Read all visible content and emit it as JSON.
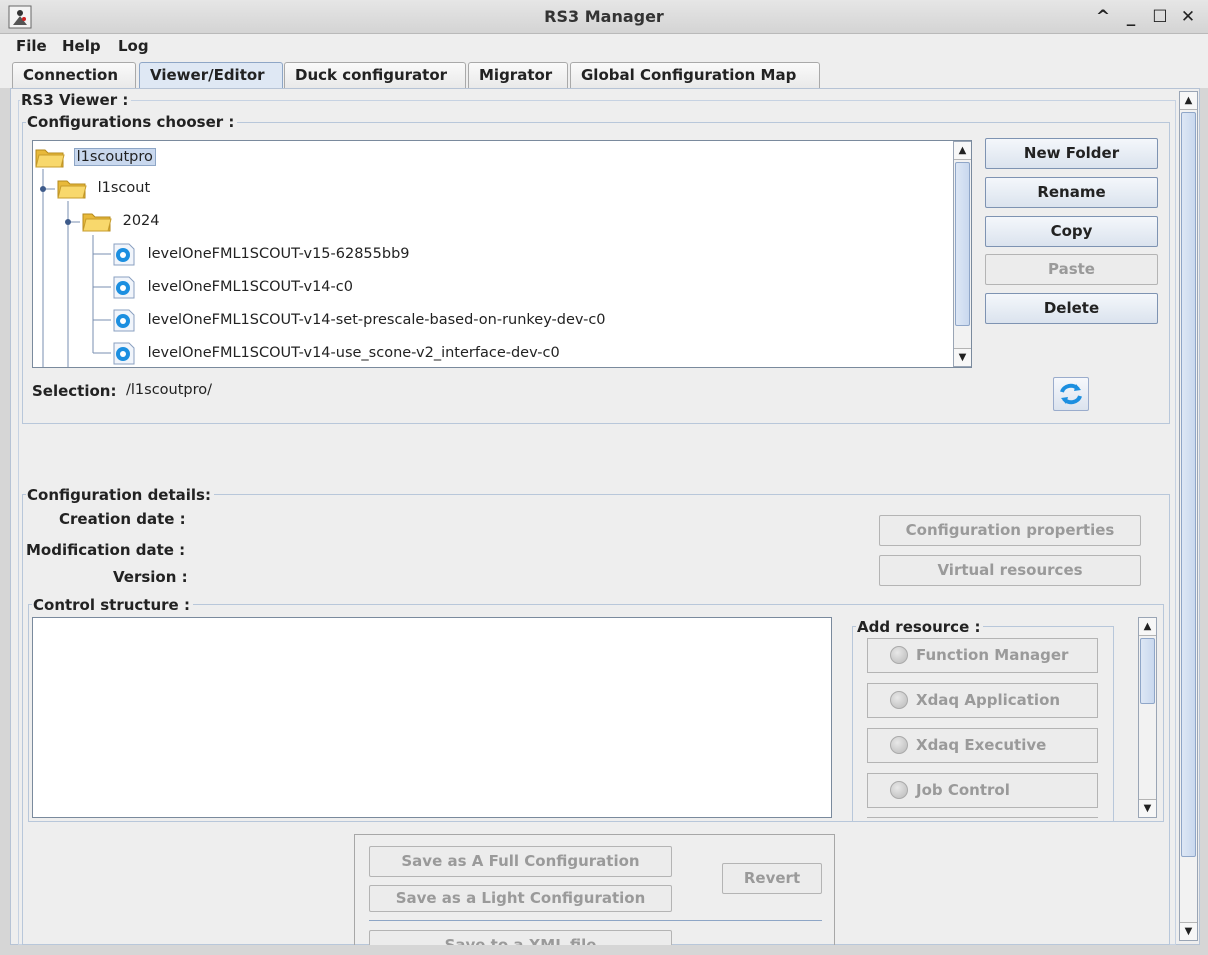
{
  "window": {
    "title": "RS3 Manager",
    "controls": {
      "collapse": "^",
      "minimize": "_",
      "maximize": "☐",
      "close": "✕"
    }
  },
  "menu": [
    "File",
    "Help",
    "Log"
  ],
  "tabs": [
    {
      "label": "Connection",
      "active": false
    },
    {
      "label": "Viewer/Editor",
      "active": true
    },
    {
      "label": "Duck configurator",
      "active": false
    },
    {
      "label": "Migrator",
      "active": false
    },
    {
      "label": "Global Configuration Map",
      "active": false
    }
  ],
  "viewer": {
    "legend": "RS3 Viewer :",
    "chooser_legend": "Configurations chooser :",
    "tree": [
      {
        "label": "l1scoutpro",
        "type": "folder",
        "level": 0,
        "selected": true
      },
      {
        "label": "l1scout",
        "type": "folder",
        "level": 1,
        "selected": false
      },
      {
        "label": "2024",
        "type": "folder",
        "level": 2,
        "selected": false
      },
      {
        "label": "levelOneFML1SCOUT-v15-62855bb9",
        "type": "config",
        "level": 3,
        "selected": false
      },
      {
        "label": "levelOneFML1SCOUT-v14-c0",
        "type": "config",
        "level": 3,
        "selected": false
      },
      {
        "label": "levelOneFML1SCOUT-v14-set-prescale-based-on-runkey-dev-c0",
        "type": "config",
        "level": 3,
        "selected": false
      },
      {
        "label": "levelOneFML1SCOUT-v14-use_scone-v2_interface-dev-c0",
        "type": "config",
        "level": 3,
        "selected": false
      }
    ],
    "buttons": {
      "new_folder": "New Folder",
      "rename": "Rename",
      "copy": "Copy",
      "paste": "Paste",
      "delete": "Delete"
    },
    "selection_label": "Selection:",
    "selection_value": "/l1scoutpro/"
  },
  "details": {
    "legend": "Configuration details:",
    "creation_label": "Creation date :",
    "modification_label": "Modification date :",
    "version_label": "Version :",
    "config_properties": "Configuration properties",
    "virtual_resources": "Virtual resources",
    "control_structure_legend": "Control structure :",
    "add_resource_legend": "Add resource :",
    "resources": [
      "Function Manager",
      "Xdaq Application",
      "Xdaq Executive",
      "Job Control"
    ]
  },
  "save": {
    "full": "Save as A Full Configuration",
    "light": "Save as a Light Configuration",
    "revert": "Revert",
    "xml": "Save to a XML file"
  },
  "colors": {
    "accent": "#8ea6c6",
    "selection": "#c9d8ee",
    "folder": "#f3cf5a",
    "gear": "#1c8fe0"
  }
}
